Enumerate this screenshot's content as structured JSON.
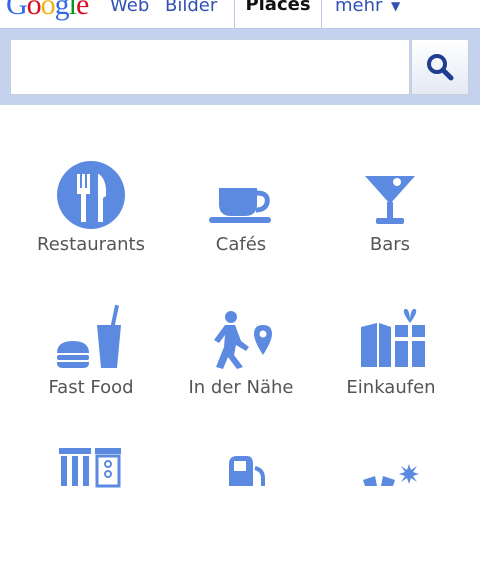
{
  "app": {
    "logo_text": "Google",
    "logo_colors": [
      "#3369e8",
      "#d50f25",
      "#eeb211",
      "#3369e8",
      "#009925",
      "#d50f25"
    ]
  },
  "nav": {
    "web": "Web",
    "images": "Bilder",
    "places": "Places",
    "more": "mehr",
    "more_arrow": "▼"
  },
  "search": {
    "value": "",
    "placeholder": "",
    "button_icon": "search-icon"
  },
  "categories": [
    {
      "label": "Restaurants",
      "icon": "fork-knife-icon"
    },
    {
      "label": "Cafés",
      "icon": "coffee-cup-icon"
    },
    {
      "label": "Bars",
      "icon": "cocktail-icon"
    },
    {
      "label": "Fast Food",
      "icon": "burger-drink-icon"
    },
    {
      "label": "In der Nähe",
      "icon": "walking-pin-icon"
    },
    {
      "label": "Einkaufen",
      "icon": "shopping-icon"
    },
    {
      "label": "",
      "icon": "bank-icon"
    },
    {
      "label": "",
      "icon": "gas-station-icon"
    },
    {
      "label": "",
      "icon": "sparkle-icon"
    }
  ],
  "colors": {
    "accent": "#5b8ae0",
    "link": "#2f51b3",
    "search_band": "#c4d2ee"
  }
}
